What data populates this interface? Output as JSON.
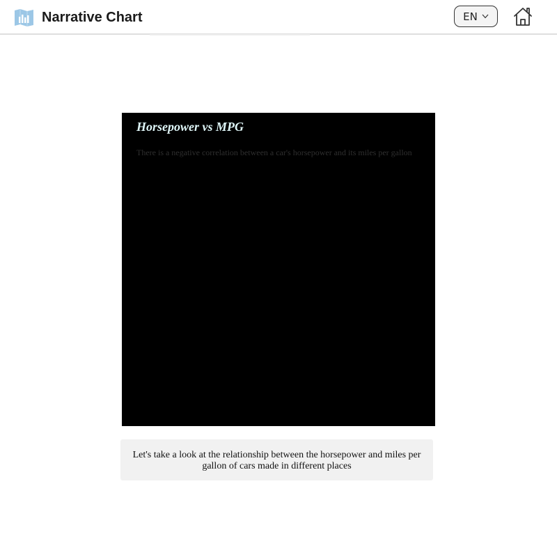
{
  "app": {
    "title": "Narrative Chart",
    "logo_icon": "bar-chart-map-icon"
  },
  "header": {
    "language_selector": {
      "selected": "EN",
      "icon": "chevron-down-icon"
    },
    "home_icon": "home-icon"
  },
  "chart": {
    "title": "Horsepower vs MPG",
    "subtitle": "There is a negative correlation between a car's horsepower and its miles per gallon",
    "background_color": "#000000",
    "title_color": "#dff6f8"
  },
  "narration": {
    "text": "Let's take a look at the relationship between the horsepower and miles per gallon of cars made in different places"
  }
}
